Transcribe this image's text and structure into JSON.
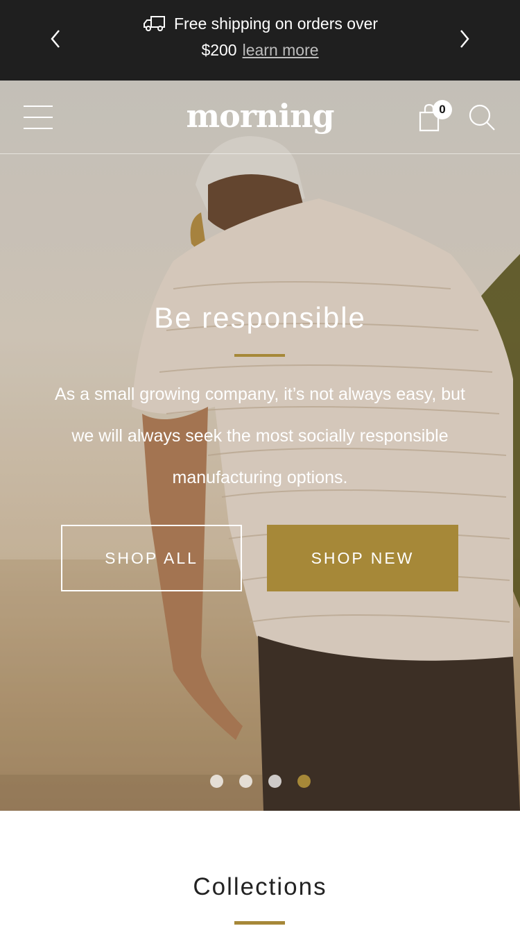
{
  "announcement": {
    "text_line1": "Free shipping on orders over",
    "text_line2": "$200",
    "link_label": "learn more",
    "icons": {
      "prev": "chevron-left-icon",
      "next": "chevron-right-icon",
      "truck": "truck-icon"
    }
  },
  "header": {
    "logo": "morning",
    "cart_count": "0",
    "icons": {
      "menu": "hamburger-menu-icon",
      "cart": "shopping-bag-icon",
      "search": "search-icon"
    }
  },
  "hero": {
    "title": "Be responsible",
    "text": "As a small growing company, it’s not always easy, but we will always seek the most socially responsible manufacturing options.",
    "buttons": {
      "shop_all": "SHOP ALL",
      "shop_new": "SHOP NEW"
    },
    "slides": {
      "count": 4,
      "active": 4
    }
  },
  "collections": {
    "title": "Collections"
  },
  "colors": {
    "accent": "#a68838",
    "announcement_bg": "#1f1f1f",
    "text_dark": "#222222"
  }
}
